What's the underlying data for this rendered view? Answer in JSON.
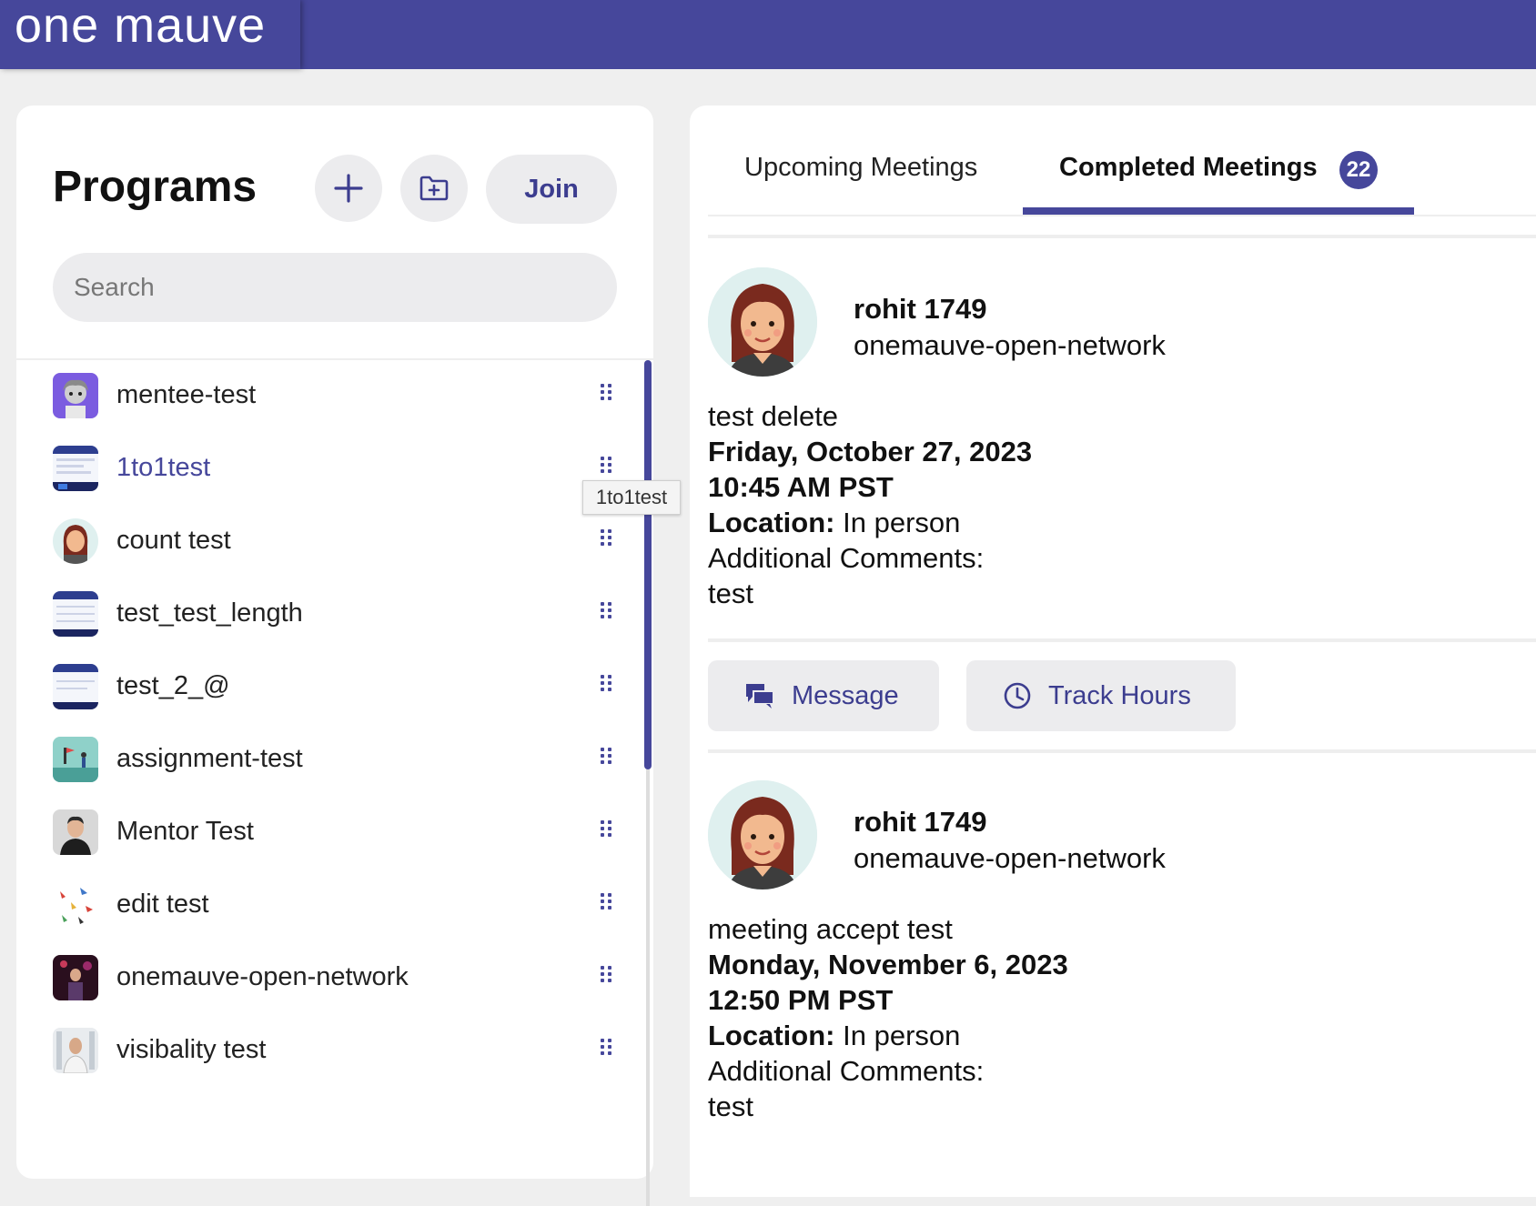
{
  "brand": {
    "logo_text": "one mauve"
  },
  "programs": {
    "title": "Programs",
    "add_icon": "plus-icon",
    "folder_icon": "folder-add-icon",
    "join_label": "Join",
    "search_placeholder": "Search",
    "items": [
      {
        "label": "mentee-test",
        "thumb": "cartoon-avatar",
        "active": false
      },
      {
        "label": "1to1test",
        "thumb": "screenshot",
        "active": true
      },
      {
        "label": "count test",
        "thumb": "woman-avatar",
        "active": false
      },
      {
        "label": "test_test_length",
        "thumb": "screenshot",
        "active": false
      },
      {
        "label": "test_2_@",
        "thumb": "screenshot",
        "active": false
      },
      {
        "label": "assignment-test",
        "thumb": "illustration",
        "active": false
      },
      {
        "label": "Mentor Test",
        "thumb": "man-photo",
        "active": false
      },
      {
        "label": "edit test",
        "thumb": "birds",
        "active": false
      },
      {
        "label": "onemauve-open-network",
        "thumb": "stage-photo",
        "active": false
      },
      {
        "label": "visibality test",
        "thumb": "man-photo-2",
        "active": false
      }
    ],
    "tooltip": "1to1test"
  },
  "tabs": {
    "upcoming": "Upcoming Meetings",
    "completed": "Completed Meetings",
    "completed_count": "22"
  },
  "meetings": [
    {
      "name": "rohit 1749",
      "program": "onemauve-open-network",
      "title": "test delete",
      "date": "Friday, October 27, 2023",
      "time": "10:45 AM PST",
      "location_label": "Location:",
      "location_value": "In person",
      "comments_label": "Additional Comments:",
      "comments": "test"
    },
    {
      "name": "rohit 1749",
      "program": "onemauve-open-network",
      "title": "meeting accept test",
      "date": "Monday, November 6, 2023",
      "time": "12:50 PM PST",
      "location_label": "Location:",
      "location_value": "In person",
      "comments_label": "Additional Comments:",
      "comments": "test"
    }
  ],
  "actions": {
    "message_label": "Message",
    "track_hours_label": "Track Hours"
  },
  "colors": {
    "brand": "#46479b",
    "button_bg": "#ececee",
    "button_text": "#3c3d8f"
  }
}
